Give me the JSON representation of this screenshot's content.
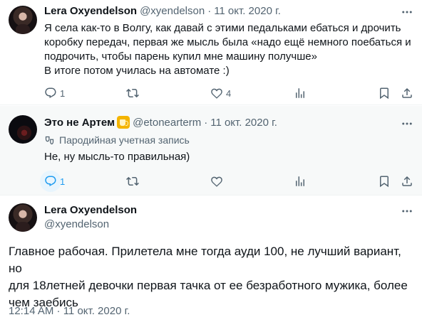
{
  "tweets": [
    {
      "author_name": "Lera Oxyendelson",
      "handle": "@xyendelson",
      "separator": "·",
      "date": "11 окт. 2020 г.",
      "text": "Я села как-то в Волгу, как давай с этими педальками ебаться и дрочить\nкоробку передач, первая же мысль была «надо ещё немного поебаться и\nподрочить, чтобы парень купил мне машину получше»\nВ итоге потом училась на автомате :)",
      "replies": "1",
      "retweets": "",
      "likes": "4"
    },
    {
      "author_name": "Это не Артем",
      "handle": "@etonearterm",
      "separator": "·",
      "date": "11 окт. 2020 г.",
      "parody_label": "Пародийная учетная запись",
      "text": "Не, ну мысль-то правильная)",
      "replies": "1",
      "retweets": "",
      "likes": ""
    }
  ],
  "main_tweet": {
    "author_name": "Lera Oxyendelson",
    "handle": "@xyendelson",
    "text": "Главное рабочая. Прилетела мне тогда ауди 100, не лучший вариант, но\nдля 18летней девочки первая тачка от ее безработного мужика, более\nчем заебись",
    "timestamp": "12:14 AM · 11 окт. 2020 г."
  },
  "colors": {
    "accent": "#1d9bf0",
    "muted": "#536471",
    "text": "#0f1419",
    "highlight_bg": "#f7f9f9"
  },
  "icons": [
    "more-icon",
    "reply-icon",
    "retweet-icon",
    "like-icon",
    "views-icon",
    "bookmark-icon",
    "share-icon",
    "parody-mask-icon",
    "beer-emoji-icon"
  ]
}
